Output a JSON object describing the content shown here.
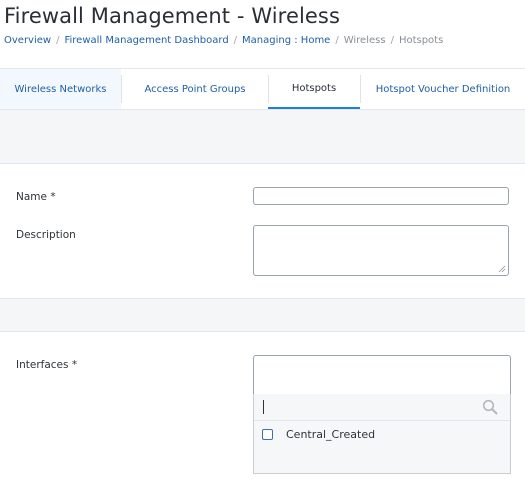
{
  "page": {
    "title": "Firewall Management - Wireless"
  },
  "breadcrumb": {
    "items": [
      "Overview",
      "Firewall Management Dashboard",
      "Managing : Home",
      "Wireless",
      "Hotspots"
    ],
    "separator": "/"
  },
  "tabs": [
    {
      "label": "Wireless Networks",
      "active": false
    },
    {
      "label": "Access Point Groups",
      "active": false
    },
    {
      "label": "Hotspots",
      "active": true
    },
    {
      "label": "Hotspot Voucher Definition",
      "active": false
    }
  ],
  "form": {
    "name_label": "Name *",
    "name_value": "",
    "description_label": "Description",
    "description_value": "",
    "interfaces_label": "Interfaces *",
    "interfaces_search_value": "",
    "interfaces_options": [
      {
        "label": "Central_Created",
        "checked": false
      }
    ]
  },
  "colors": {
    "link": "#1f5fa8",
    "active_tab_underline": "#1f7fd0",
    "checkbox_border": "#3d6fb0"
  },
  "icons": {
    "search": "search-icon"
  }
}
